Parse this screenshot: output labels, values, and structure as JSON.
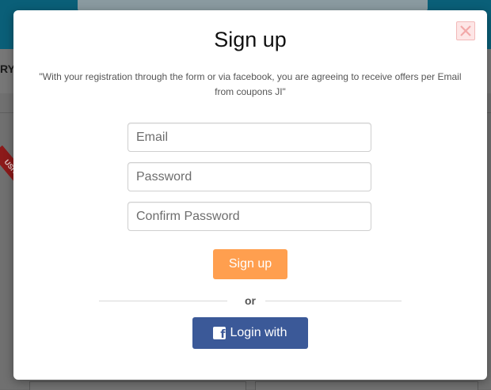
{
  "background": {
    "nav_partial_text": "RY",
    "ribbon_text": "USIV"
  },
  "modal": {
    "title": "Sign up",
    "notice": "\"With your registration through the form or via facebook, you are agreeing to receive offers per Email from coupons JI\"",
    "fields": {
      "email_placeholder": "Email",
      "password_placeholder": "Password",
      "confirm_placeholder": "Confirm Password"
    },
    "signup_label": "Sign up",
    "divider_text": "or",
    "facebook_label": "Login with",
    "close_icon": "close-icon",
    "facebook_icon": "facebook-icon"
  },
  "colors": {
    "signup_button": "#ff9f4f",
    "facebook_button": "#3b5998",
    "close_button_bg": "#fde6e6"
  }
}
